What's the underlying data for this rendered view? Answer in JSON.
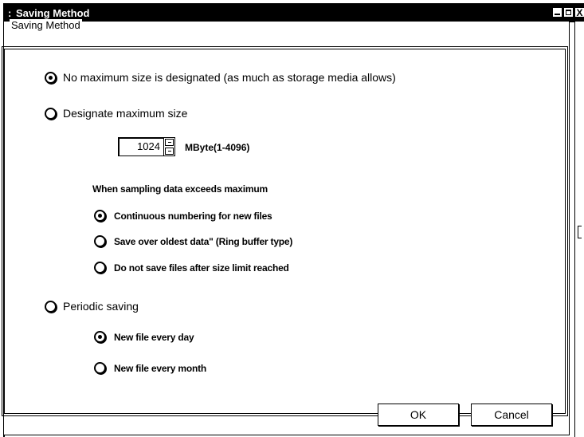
{
  "window": {
    "title": "Saving Method",
    "grip": ":"
  },
  "group": {
    "legend": "Saving Method"
  },
  "options": {
    "no_max": {
      "label": "No maximum size is designated (as much as storage media allows)",
      "checked": true
    },
    "designate_max": {
      "label": "Designate maximum size",
      "checked": false
    },
    "periodic": {
      "label": "Periodic saving",
      "checked": false
    }
  },
  "max_size": {
    "value": "1024",
    "unit_label": "MByte(1-4096)"
  },
  "exceed": {
    "heading": "When sampling data exceeds maximum",
    "continuous": {
      "label": "Continuous numbering for new files",
      "checked": true
    },
    "save_over": {
      "label": "Save over oldest data\" (Ring buffer type)",
      "checked": false
    },
    "do_not_save": {
      "label": "Do not save files after size limit reached",
      "checked": false
    }
  },
  "periodic_options": {
    "every_day": {
      "label": "New file every day",
      "checked": true
    },
    "every_month": {
      "label": "New file every month",
      "checked": false
    }
  },
  "buttons": {
    "ok": "OK",
    "cancel": "Cancel"
  },
  "title_buttons": {
    "close": "X"
  }
}
